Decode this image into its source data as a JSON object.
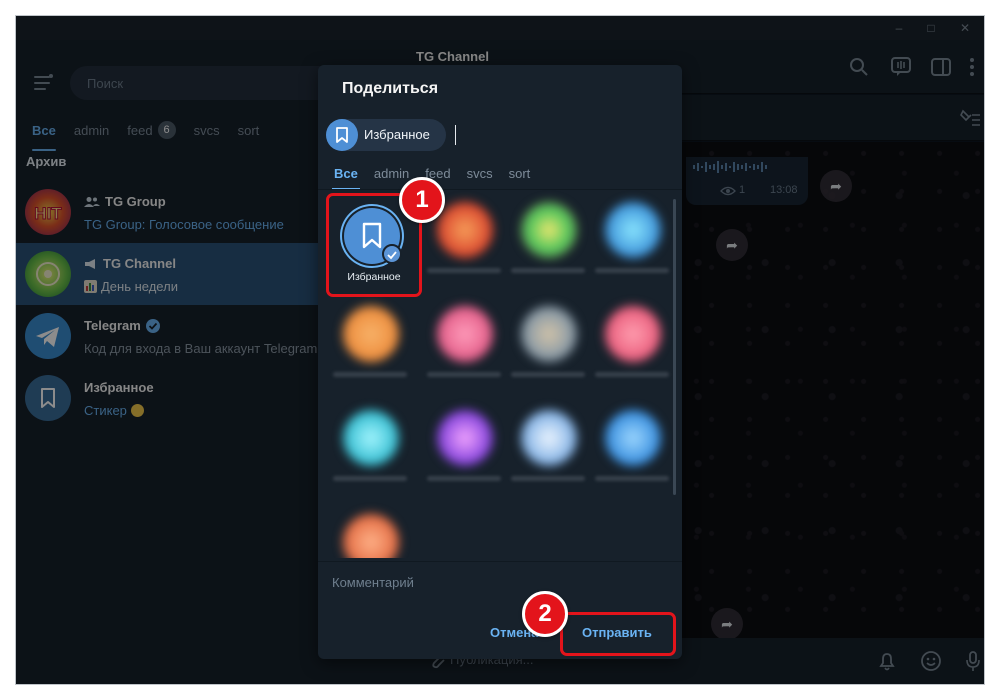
{
  "window": {
    "min_glyph": "–",
    "max_glyph": "□",
    "close_glyph": "✕"
  },
  "sidebar": {
    "search_placeholder": "Поиск",
    "folders": [
      {
        "label": "Все",
        "active": true
      },
      {
        "label": "admin"
      },
      {
        "label": "feed",
        "badge": "6"
      },
      {
        "label": "svcs"
      },
      {
        "label": "sort"
      }
    ],
    "archive_label": "Архив",
    "chats": [
      {
        "name": "TG Group",
        "prefix_icon": "group-icon",
        "message": "TG Group: Голосовое сообщение",
        "avatar_text": "HIT"
      },
      {
        "name": "TG Channel",
        "prefix_icon": "megaphone-icon",
        "message": "День недели",
        "selected": true
      },
      {
        "name": "Telegram",
        "verified": true,
        "message": "Код для входа в Ваш аккаунт Telegram"
      },
      {
        "name": "Избранное",
        "message": "Стикер",
        "avatar_icon": "bookmark-icon"
      }
    ]
  },
  "conversation": {
    "title": "TG Channel",
    "post_views": "1",
    "post_time": "13:08",
    "composer_placeholder": "Публикация..."
  },
  "share_dialog": {
    "title": "Поделиться",
    "selected_chip": "Избранное",
    "tabs": [
      "Все",
      "admin",
      "feed",
      "svcs",
      "sort"
    ],
    "active_tab": "Все",
    "first_target_label": "Избранное",
    "comment_placeholder": "Комментарий",
    "cancel_label": "Отмена",
    "send_label": "Отправить"
  },
  "annotations": {
    "callout_1": "1",
    "callout_2": "2",
    "accent_color": "#e3141b"
  },
  "colors": {
    "accent": "#6ab3f3",
    "panel": "#17212b",
    "selected_chat": "#2b5278",
    "avatar_blue": "#4e8fd5"
  }
}
